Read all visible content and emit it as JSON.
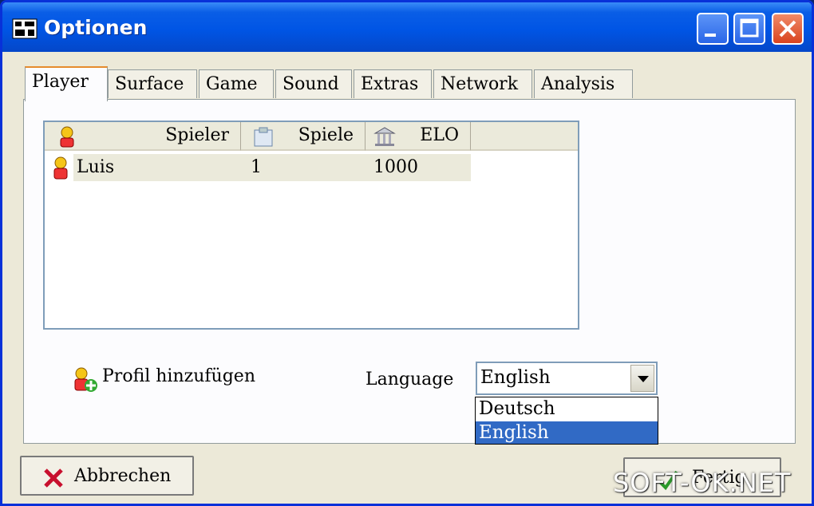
{
  "window": {
    "title": "Optionen"
  },
  "tabs": [
    "Player",
    "Surface",
    "Game",
    "Sound",
    "Extras",
    "Network",
    "Analysis"
  ],
  "list": {
    "columns": [
      "Spieler",
      "Spiele",
      "ELO"
    ],
    "rows": [
      {
        "player": "Luis",
        "games": "1",
        "elo": "1000"
      }
    ]
  },
  "add_profile_label": "Profil hinzufügen",
  "language": {
    "label": "Language",
    "selected": "English",
    "options": [
      "Deutsch",
      "English"
    ]
  },
  "buttons": {
    "cancel": "Abbrechen",
    "ok": "Fertig"
  },
  "watermark": "SOFT-OK.NET",
  "colors": {
    "titlebar": "#0055e5",
    "selection": "#316ac5",
    "face": "#ece9d8"
  }
}
